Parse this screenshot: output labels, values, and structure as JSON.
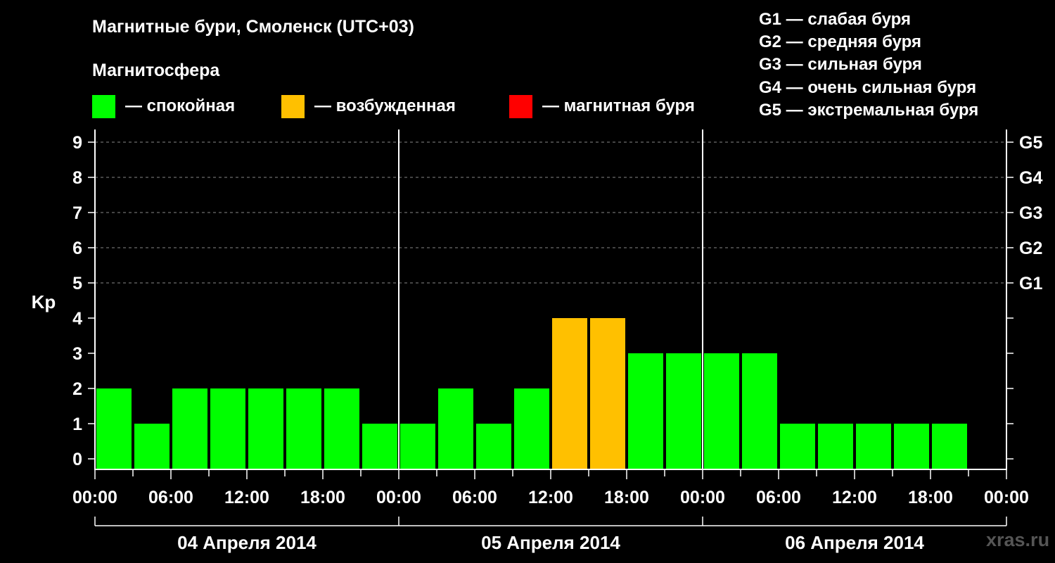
{
  "header": {
    "title": "Магнитные бури, Смоленск (UTC+03)",
    "subtitle": "Магнитосфера"
  },
  "legend": [
    {
      "label": "— спокойная",
      "color": "#00ff00"
    },
    {
      "label": "— возбужденная",
      "color": "#ffc000"
    },
    {
      "label": "— магнитная буря",
      "color": "#ff0000"
    }
  ],
  "storm_scale": [
    "G1 — слабая буря",
    "G2 — средняя буря",
    "G3 — сильная буря",
    "G4 — очень сильная буря",
    "G5 — экстремальная буря"
  ],
  "watermark": "xras.ru",
  "chart_data": {
    "type": "bar",
    "ylabel": "Kp",
    "ylim": [
      0,
      9
    ],
    "yticks": [
      "0",
      "1",
      "2",
      "3",
      "4",
      "5",
      "6",
      "7",
      "8",
      "9"
    ],
    "right_axis_labels": [
      {
        "kp": 5,
        "label": "G1"
      },
      {
        "kp": 6,
        "label": "G2"
      },
      {
        "kp": 7,
        "label": "G3"
      },
      {
        "kp": 8,
        "label": "G4"
      },
      {
        "kp": 9,
        "label": "G5"
      }
    ],
    "xtick_labels": [
      "00:00",
      "06:00",
      "12:00",
      "18:00",
      "00:00",
      "06:00",
      "12:00",
      "18:00",
      "00:00",
      "06:00",
      "12:00",
      "18:00",
      "00:00"
    ],
    "days": [
      "04 Апреля 2014",
      "05 Апреля 2014",
      "06 Апреля 2014"
    ],
    "bar_interval_hours": 3,
    "values": [
      2,
      1,
      2,
      2,
      2,
      2,
      2,
      1,
      1,
      2,
      1,
      2,
      4,
      4,
      3,
      3,
      3,
      3,
      1,
      1,
      1,
      1,
      1
    ],
    "value_colors": {
      "quiet": "#00ff00",
      "unsettled": "#ffc000",
      "storm": "#ff0000"
    },
    "grid": "dashed horizontal at Kp 5–9"
  }
}
